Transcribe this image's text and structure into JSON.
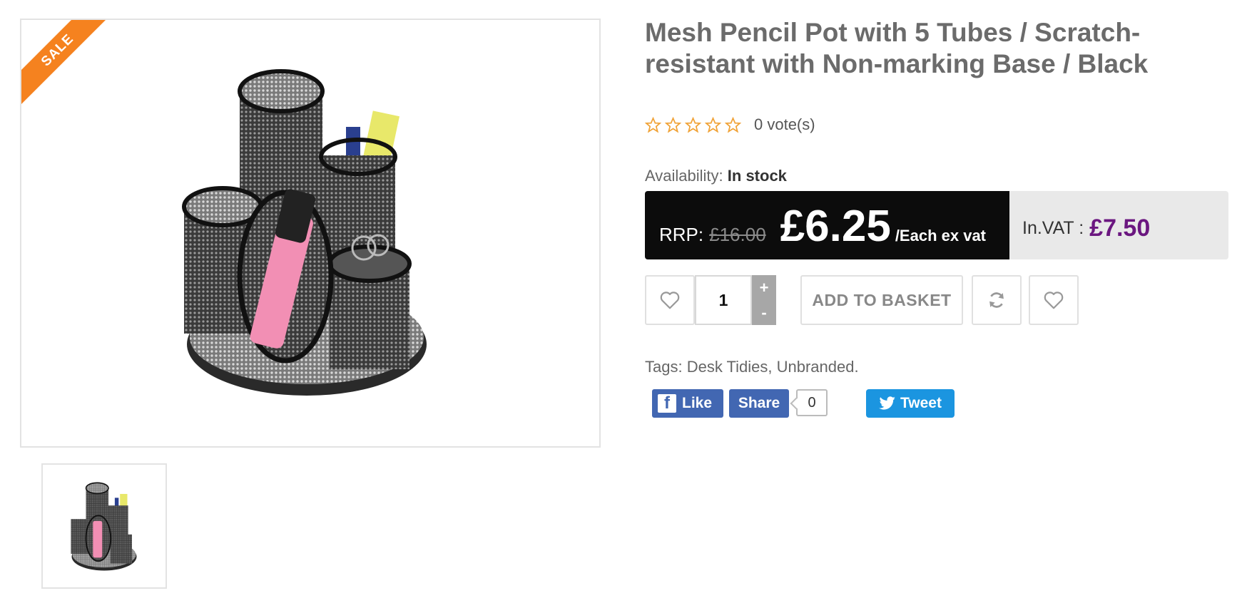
{
  "product": {
    "badge": "SALE",
    "title": "Mesh Pencil Pot with 5 Tubes / Scratch-resistant with Non-marking Base / Black",
    "rating": {
      "stars": 5,
      "votes_text": "0 vote(s)"
    },
    "availability": {
      "label": "Availability:",
      "value": "In stock"
    },
    "price": {
      "rrp_label": "RRP:",
      "rrp_value": "£16.00",
      "main": "£6.25",
      "unit": "/Each ex vat",
      "vat_label": "In.VAT :",
      "vat_value": "£7.50"
    },
    "actions": {
      "quantity": "1",
      "plus": "+",
      "minus": "-",
      "add_to_basket": "ADD TO BASKET"
    },
    "tags_text": "Tags: Desk Tidies, Unbranded."
  },
  "social": {
    "like": "Like",
    "share": "Share",
    "share_count": "0",
    "tweet": "Tweet"
  },
  "colors": {
    "sale_badge": "#f5821f",
    "price_dark_bg": "#0c0c0c",
    "vat_price": "#6b1780",
    "facebook": "#4267b2",
    "twitter": "#1b95e0",
    "star": "#f0a236"
  },
  "icons": {
    "wishlist": "heart-icon",
    "compare": "refresh-icon",
    "rating": "star-outline-icon",
    "facebook": "facebook-logo-icon",
    "twitter": "twitter-bird-icon"
  }
}
